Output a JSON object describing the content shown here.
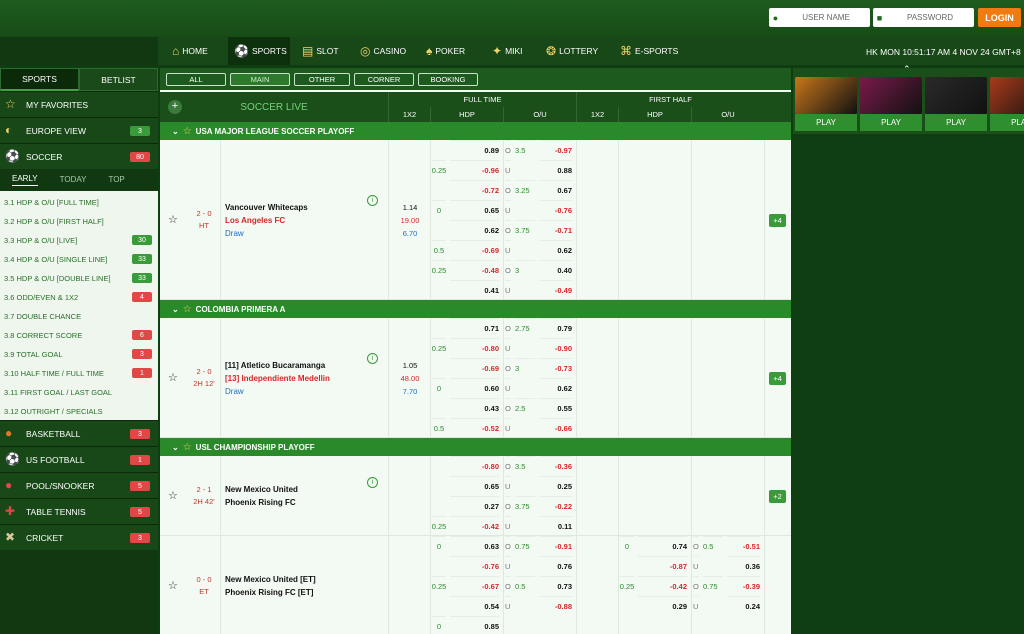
{
  "header": {
    "username_placeholder": "USER NAME",
    "password_placeholder": "PASSWORD",
    "login_label": "LOGIN"
  },
  "nav": {
    "items": [
      {
        "label": "HOME",
        "icon": "home-icon"
      },
      {
        "label": "SPORTS",
        "icon": "soccer-ball-icon"
      },
      {
        "label": "SLOT",
        "icon": "slot-icon"
      },
      {
        "label": "CASINO",
        "icon": "chip-icon"
      },
      {
        "label": "POKER",
        "icon": "cards-icon"
      },
      {
        "label": "MIKI",
        "icon": "miki-icon"
      },
      {
        "label": "LOTTERY",
        "icon": "lottery-icon"
      },
      {
        "label": "E-SPORTS",
        "icon": "gamepad-icon"
      }
    ],
    "clock": "HK MON 10:51:17 AM 4 NOV 24 GMT+8"
  },
  "sidebar": {
    "tabs": [
      "SPORTS",
      "BETLIST"
    ],
    "top": [
      {
        "label": "MY FAVORITES",
        "icon": "star-icon"
      },
      {
        "label": "EUROPE VIEW",
        "icon": "europe-icon",
        "count": "3"
      },
      {
        "label": "SOCCER",
        "icon": "soccer-icon",
        "count": "80"
      }
    ],
    "subtabs": [
      "EARLY",
      "TODAY",
      "TOP"
    ],
    "markets": [
      {
        "label": "3.1 HDP & O/U [FULL TIME]",
        "count": ""
      },
      {
        "label": "3.2 HDP & O/U [FIRST HALF]",
        "count": ""
      },
      {
        "label": "3.3 HDP & O/U [LIVE]",
        "count": "30"
      },
      {
        "label": "3.4 HDP & O/U [SINGLE LINE]",
        "count": "33"
      },
      {
        "label": "3.5 HDP & O/U [DOUBLE LINE]",
        "count": "33"
      },
      {
        "label": "3.6 ODD/EVEN & 1X2",
        "count": "4"
      },
      {
        "label": "3.7 DOUBLE CHANCE",
        "count": ""
      },
      {
        "label": "3.8 CORRECT SCORE",
        "count": "6"
      },
      {
        "label": "3.9 TOTAL GOAL",
        "count": "3"
      },
      {
        "label": "3.10 HALF TIME / FULL TIME",
        "count": "1"
      },
      {
        "label": "3.11 FIRST GOAL / LAST GOAL",
        "count": ""
      },
      {
        "label": "3.12 OUTRIGHT / SPECIALS",
        "count": ""
      }
    ],
    "bottom": [
      {
        "label": "BASKETBALL",
        "icon": "basketball-icon",
        "count": "3"
      },
      {
        "label": "US FOOTBALL",
        "icon": "us-football-icon",
        "count": "1"
      },
      {
        "label": "POOL/SNOOKER",
        "icon": "pool-icon",
        "count": "5"
      },
      {
        "label": "TABLE TENNIS",
        "icon": "table-tennis-icon",
        "count": "5"
      },
      {
        "label": "CRICKET",
        "icon": "cricket-icon",
        "count": "3"
      }
    ]
  },
  "filters": [
    "ALL",
    "MAIN",
    "OTHER",
    "CORNER",
    "BOOKING"
  ],
  "table": {
    "title": "SOCCER LIVE",
    "full_time": "FULL TIME",
    "first_half": "FIRST HALF",
    "cols": [
      "1X2",
      "HDP",
      "O/U",
      "1X2",
      "HDP",
      "O/U"
    ]
  },
  "leagues": [
    {
      "name": "USA MAJOR LEAGUE SOCCER PLAYOFF",
      "matches": [
        {
          "score": "2 - 0",
          "time": "HT",
          "home": "Vancouver Whitecaps",
          "away": "Los Angeles FC",
          "draw": "Draw",
          "x12": [
            "1.14",
            "19.00",
            "6.70"
          ],
          "more": "+4",
          "rows": [
            [
              "",
              "0.89",
              "O",
              "3.5",
              "-0.97"
            ],
            [
              "0.25",
              "-0.96",
              "U",
              "",
              "0.88"
            ],
            [
              "",
              "-0.72",
              "O",
              "3.25",
              "0.67"
            ],
            [
              "0",
              "0.65",
              "U",
              "",
              "-0.76"
            ],
            [
              "",
              "0.62",
              "O",
              "3.75",
              "-0.71"
            ],
            [
              "0.5",
              "-0.69",
              "U",
              "",
              "0.62"
            ],
            [
              "0.25",
              "-0.48",
              "O",
              "3",
              "0.40"
            ],
            [
              "",
              "0.41",
              "U",
              "",
              "-0.49"
            ]
          ],
          "fh": []
        }
      ]
    },
    {
      "name": "COLOMBIA PRIMERA A",
      "matches": [
        {
          "score": "2 - 0",
          "time": "2H 12'",
          "home": "[11] Atletico Bucaramanga",
          "away": "[13] Independiente Medellin",
          "draw": "Draw",
          "x12": [
            "1.05",
            "48.00",
            "7.70"
          ],
          "more": "+4",
          "rows": [
            [
              "",
              "0.71",
              "O",
              "2.75",
              "0.79"
            ],
            [
              "0.25",
              "-0.80",
              "U",
              "",
              "-0.90"
            ],
            [
              "",
              "-0.69",
              "O",
              "3",
              "-0.73"
            ],
            [
              "0",
              "0.60",
              "U",
              "",
              "0.62"
            ],
            [
              "",
              "0.43",
              "O",
              "2.5",
              "0.55"
            ],
            [
              "0.5",
              "-0.52",
              "U",
              "",
              "-0.66"
            ]
          ],
          "fh": []
        }
      ]
    },
    {
      "name": "USL CHAMPIONSHIP PLAYOFF",
      "matches": [
        {
          "score": "2 - 1",
          "time": "2H 42'",
          "home": "New Mexico United",
          "away": "Phoenix Rising FC",
          "draw": "",
          "x12": [
            "",
            "",
            ""
          ],
          "more": "+2",
          "rows": [
            [
              "",
              "-0.80",
              "O",
              "3.5",
              "-0.36"
            ],
            [
              "",
              "0.65",
              "U",
              "",
              "0.25"
            ],
            [
              "",
              "0.27",
              "O",
              "3.75",
              "-0.22"
            ],
            [
              "0.25",
              "-0.42",
              "U",
              "",
              "0.11"
            ]
          ],
          "fh": []
        },
        {
          "score": "0 - 0",
          "time": "ET",
          "home": "New Mexico United [ET]",
          "away": "Phoenix Rising FC [ET]",
          "draw": "",
          "x12": [
            "",
            "",
            ""
          ],
          "more": "",
          "rows": [
            [
              "0",
              "0.63",
              "O",
              "0.75",
              "-0.91"
            ],
            [
              "",
              "-0.76",
              "U",
              "",
              "0.76"
            ],
            [
              "0.25",
              "-0.67",
              "O",
              "0.5",
              "0.73"
            ],
            [
              "",
              "0.54",
              "U",
              "",
              "-0.88"
            ],
            [
              "0",
              "0.85",
              "",
              "",
              ""
            ]
          ],
          "fh": [
            [
              "0",
              "0.74",
              "O",
              "0.5",
              "-0.51"
            ],
            [
              "",
              "-0.87",
              "U",
              "",
              "0.36"
            ],
            [
              "0.25",
              "-0.42",
              "O",
              "0.75",
              "-0.39"
            ],
            [
              "",
              "0.29",
              "U",
              "",
              "0.24"
            ]
          ]
        }
      ]
    }
  ],
  "games": [
    {
      "label": "PLAY",
      "color": "#c9771a"
    },
    {
      "label": "PLAY",
      "color": "#7a1a4a"
    },
    {
      "label": "PLAY",
      "color": "#2a2a2a"
    },
    {
      "label": "PLAY",
      "color": "#a83a1a"
    }
  ]
}
